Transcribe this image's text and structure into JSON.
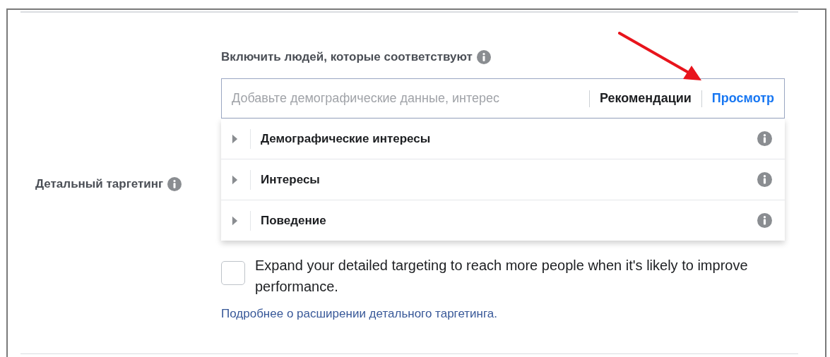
{
  "section": {
    "label": "Детальный таргетинг",
    "include_heading": "Включить людей, которые соответствуют",
    "search": {
      "placeholder": "Добавьте демографические данные, интерес"
    },
    "actions": [
      {
        "label": "Рекомендации",
        "selected": false
      },
      {
        "label": "Просмотр",
        "selected": true
      }
    ],
    "categories": [
      {
        "label": "Демографические интересы",
        "expanded": false
      },
      {
        "label": "Интересы",
        "expanded": false
      },
      {
        "label": "Поведение",
        "expanded": false
      }
    ],
    "expand_option": {
      "label": "Expand your detailed targeting to reach more people when it's likely to improve performance.",
      "checked": false
    },
    "learn_more_link": "Подробнее о расширении детального таргетинга."
  }
}
